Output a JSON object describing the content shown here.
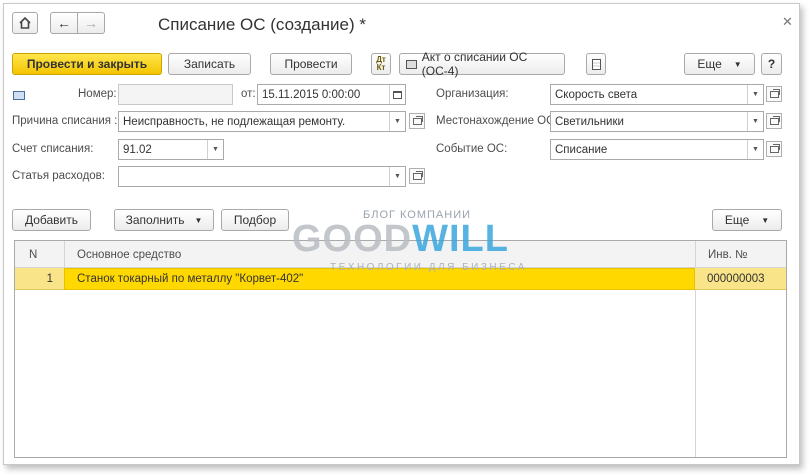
{
  "title": "Списание ОС (создание) *",
  "toolbar": {
    "post_close": "Провести и закрыть",
    "save": "Записать",
    "post": "Провести",
    "print_act": "Акт о списании ОС (ОС-4)",
    "more": "Еще",
    "help": "?"
  },
  "form": {
    "number_label": "Номер:",
    "number_value": "",
    "date_label": "от:",
    "date_value": "15.11.2015  0:00:00",
    "reason_label": "Причина списания :",
    "reason_value": "Неисправность, не подлежащая ремонту.",
    "account_label": "Счет списания:",
    "account_value": "91.02",
    "expense_label": "Статья расходов:",
    "expense_value": "",
    "org_label": "Организация:",
    "org_value": "Скорость света",
    "location_label": "Местонахождение ОС:",
    "location_value": "Светильники",
    "event_label": "Событие ОС:",
    "event_value": "Списание"
  },
  "table_toolbar": {
    "add": "Добавить",
    "fill": "Заполнить",
    "select": "Подбор",
    "more": "Еще"
  },
  "table": {
    "columns": [
      "N",
      "Основное средство",
      "Инв. №"
    ],
    "rows": [
      {
        "n": "1",
        "asset": "Станок токарный по металлу \"Корвет-402\"",
        "inv": "000000003"
      }
    ]
  },
  "watermark": {
    "top": "БЛОГ КОМПАНИИ",
    "brand_gray": "GOOD",
    "brand_blue": "WILL",
    "sub": "ТЕХНОЛОГИИ ДЛЯ БИЗНЕСА"
  },
  "colors": {
    "accent_yellow": "#f4c400",
    "row_highlight": "#f9e48a",
    "brand_blue": "#3aa7dd"
  }
}
